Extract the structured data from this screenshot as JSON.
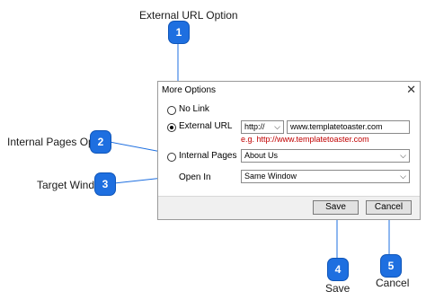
{
  "callouts": {
    "c1": {
      "number": "1",
      "label": "External URL Option"
    },
    "c2": {
      "number": "2",
      "label": "Internal Pages Option"
    },
    "c3": {
      "number": "3",
      "label": "Target Window"
    },
    "c4": {
      "number": "4",
      "label": "Save"
    },
    "c5": {
      "number": "5",
      "label": "Cancel"
    }
  },
  "dialog": {
    "title": "More Options",
    "close_icon": "close-icon",
    "options": {
      "no_link": "No Link",
      "external_url": "External URL",
      "internal_pages": "Internal Pages",
      "open_in": "Open In",
      "selected": "external_url"
    },
    "protocol_select": "http://",
    "url_input_value": "www.templatetoaster.com",
    "example_hint": "e.g. http://www.templatetoaster.com",
    "internal_pages_select": "About Us",
    "open_in_select": "Same Window",
    "save_label": "Save",
    "cancel_label": "Cancel"
  },
  "colors": {
    "badge": "#1e6fe0",
    "hint": "#c00000"
  }
}
